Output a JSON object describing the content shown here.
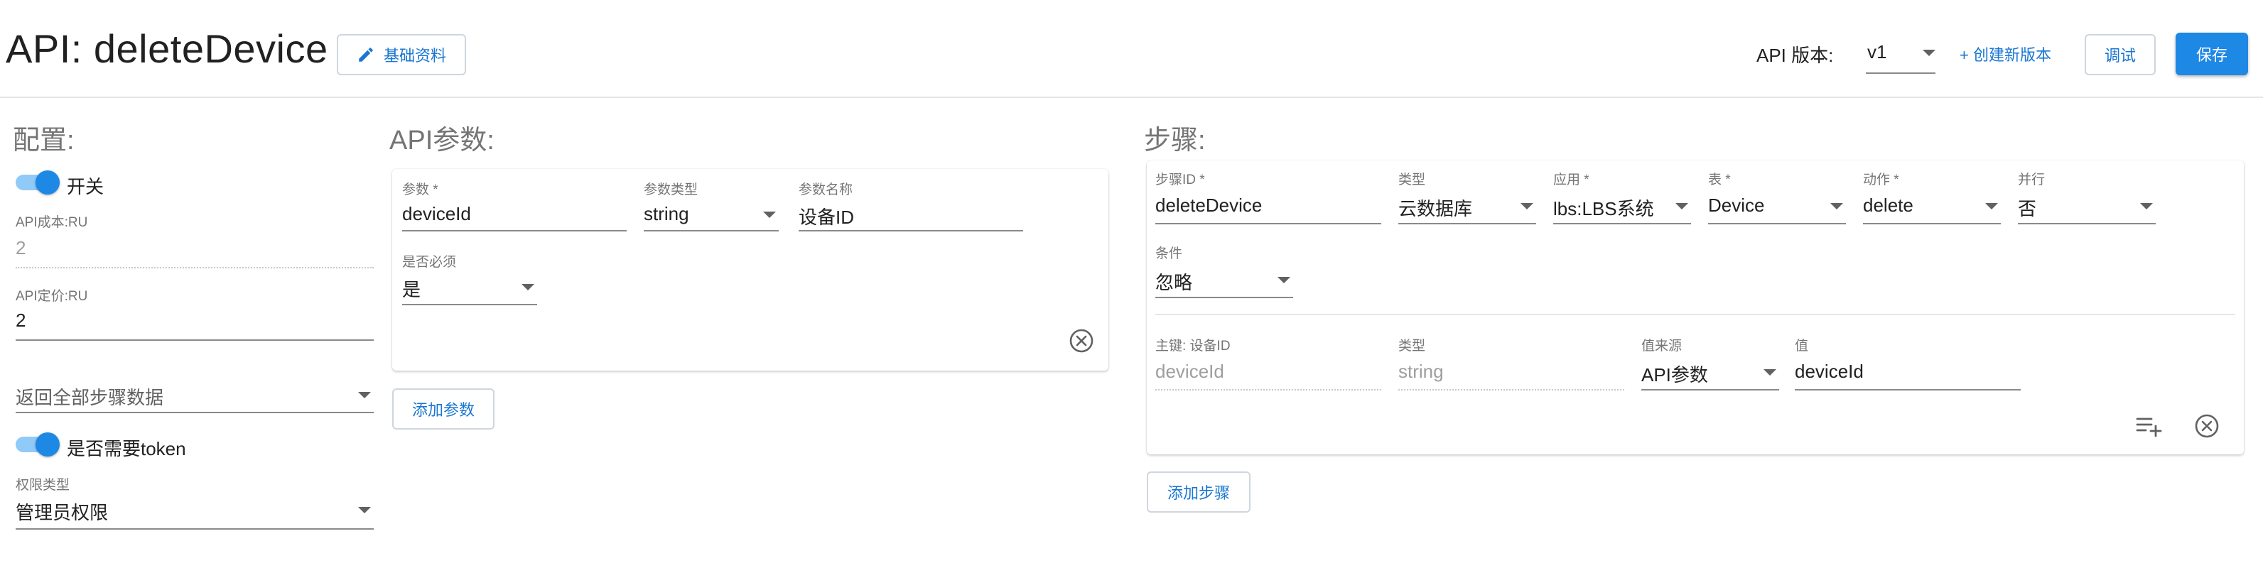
{
  "header": {
    "title": "API: deleteDevice",
    "basic_info_label": "基础资料",
    "version_label": "API 版本:",
    "version_value": "v1",
    "new_version_label": "+ 创建新版本",
    "debug_label": "调试",
    "save_label": "保存"
  },
  "config": {
    "title": "配置:",
    "switch_label": "开关",
    "cost_label": "API成本:RU",
    "cost_value": "2",
    "price_label": "API定价:RU",
    "price_value": "2",
    "return_select": "返回全部步骤数据",
    "token_label": "是否需要token",
    "permission_label": "权限类型",
    "permission_value": "管理员权限"
  },
  "params": {
    "title": "API参数:",
    "param_label": "参数 *",
    "param_value": "deviceId",
    "type_label": "参数类型",
    "type_value": "string",
    "name_label": "参数名称",
    "name_value": "设备ID",
    "required_label": "是否必须",
    "required_value": "是",
    "add_label": "添加参数"
  },
  "steps": {
    "title": "步骤:",
    "step_id_label": "步骤ID *",
    "step_id_value": "deleteDevice",
    "type_label": "类型",
    "type_value": "云数据库",
    "app_label": "应用 *",
    "app_value": "lbs:LBS系统",
    "table_label": "表 *",
    "table_value": "Device",
    "action_label": "动作 *",
    "action_value": "delete",
    "parallel_label": "并行",
    "parallel_value": "否",
    "condition_label": "条件",
    "condition_value": "忽略",
    "key_label": "主键: 设备ID",
    "key_value": "deviceId",
    "key_type_label": "类型",
    "key_type_value": "string",
    "source_label": "值来源",
    "source_value": "API参数",
    "value_label": "值",
    "value_value": "deviceId",
    "add_label": "添加步骤"
  },
  "colors": {
    "primary": "#1e88e5",
    "link": "#1976d2",
    "toggle_track": "#90caf9"
  }
}
